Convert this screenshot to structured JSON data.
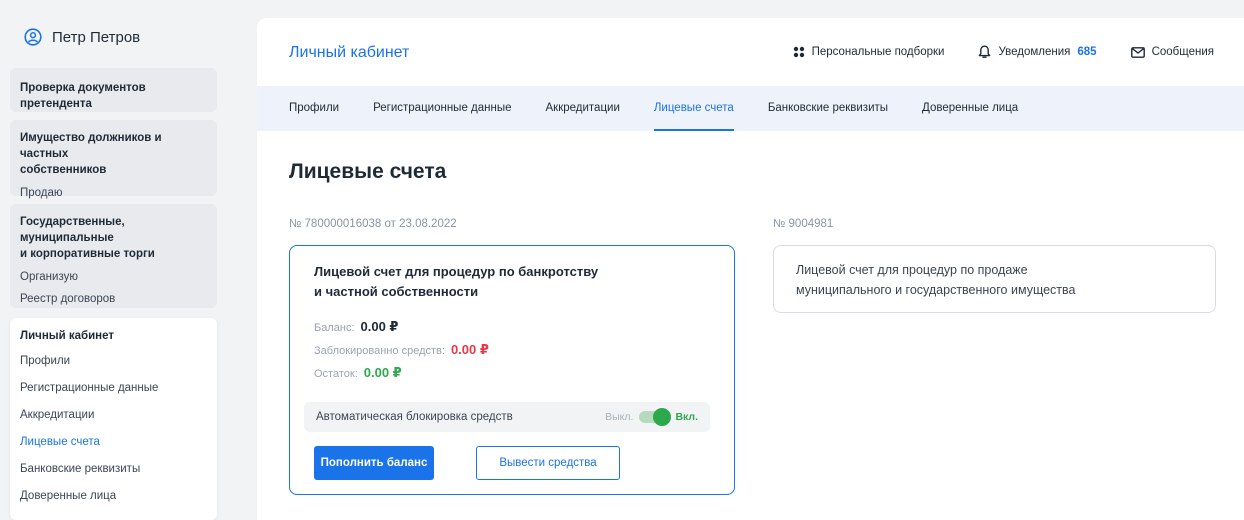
{
  "user": {
    "name": "Петр Петров"
  },
  "sidebar": {
    "card1": {
      "title": "Проверка документов претендента"
    },
    "card2": {
      "title_line1": "Имущество должников и частных",
      "title_line2": "собственников",
      "items": [
        "Продаю"
      ]
    },
    "card3": {
      "title_line1": "Государственные, муниципальные",
      "title_line2": "и корпоративные торги",
      "items": [
        "Организую",
        "Реестр договоров"
      ]
    },
    "card4": {
      "title": "Личный кабинет",
      "items": [
        "Профили",
        "Регистрационные данные",
        "Аккредитации",
        "Лицевые счета",
        "Банковские реквизиты",
        "Доверенные лица"
      ]
    }
  },
  "header": {
    "title": "Личный кабинет",
    "personal": "Персональные подборки",
    "notifications": "Уведомления",
    "notifications_count": "685",
    "messages": "Сообщения"
  },
  "tabs": [
    "Профили",
    "Регистрационные данные",
    "Аккредитации",
    "Лицевые счета",
    "Банковские реквизиты",
    "Доверенные лица"
  ],
  "page": {
    "title": "Лицевые счета"
  },
  "account1": {
    "label": "№ 780000016038 от 23.08.2022",
    "heading_line1": "Лицевой счет для процедур по банкротству",
    "heading_line2": "и частной собственности",
    "balance_label": "Баланс:",
    "balance_value": "0.00 ₽",
    "blocked_label": "Заблокированно средств:",
    "blocked_value": "0.00 ₽",
    "rest_label": "Остаток:",
    "rest_value": "0.00 ₽",
    "auto_block_label": "Автоматическая блокировка средств",
    "toggle_off": "Выкл.",
    "toggle_on": "Вкл.",
    "topup_button": "Пополнить баланс",
    "withdraw_button": "Вывести средства"
  },
  "account2": {
    "label": "№ 9004981",
    "heading_line1": "Лицевой счет для процедур по продаже",
    "heading_line2": "муниципального и государственного имущества"
  },
  "colors": {
    "accent": "#1a73e8",
    "negative": "#e53946",
    "positive": "#2ea84d"
  }
}
